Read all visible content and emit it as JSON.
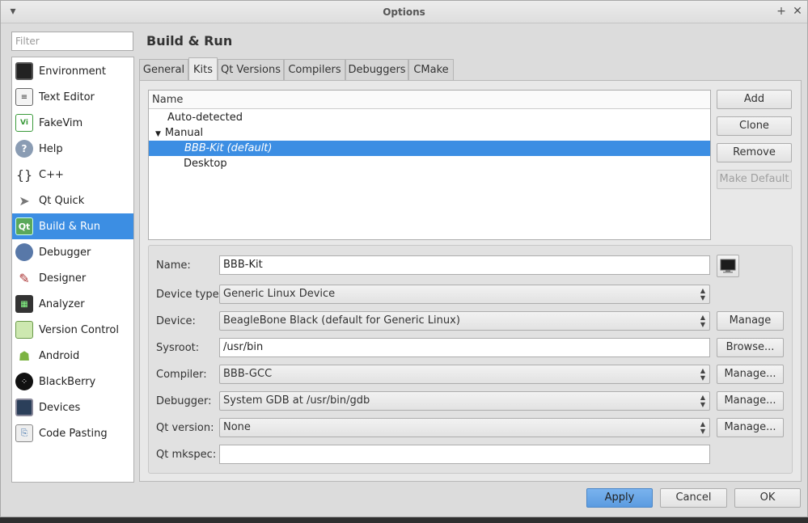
{
  "window": {
    "title": "Options"
  },
  "filter": {
    "placeholder": "Filter"
  },
  "sidebar": {
    "items": [
      {
        "label": "Environment",
        "icon": "monitor-icon"
      },
      {
        "label": "Text Editor",
        "icon": "text-editor-icon"
      },
      {
        "label": "FakeVim",
        "icon": "fakevim-icon"
      },
      {
        "label": "Help",
        "icon": "help-icon"
      },
      {
        "label": "C++",
        "icon": "cpp-braces-icon"
      },
      {
        "label": "Qt Quick",
        "icon": "paper-plane-icon"
      },
      {
        "label": "Build & Run",
        "icon": "qt-build-icon",
        "selected": true
      },
      {
        "label": "Debugger",
        "icon": "bug-icon"
      },
      {
        "label": "Designer",
        "icon": "designer-pen-icon"
      },
      {
        "label": "Analyzer",
        "icon": "analyzer-icon"
      },
      {
        "label": "Version Control",
        "icon": "version-control-icon"
      },
      {
        "label": "Android",
        "icon": "android-icon"
      },
      {
        "label": "BlackBerry",
        "icon": "blackberry-icon"
      },
      {
        "label": "Devices",
        "icon": "device-icon"
      },
      {
        "label": "Code Pasting",
        "icon": "code-paste-icon"
      }
    ]
  },
  "main": {
    "title": "Build & Run",
    "tabs": [
      "General",
      "Kits",
      "Qt Versions",
      "Compilers",
      "Debuggers",
      "CMake"
    ],
    "active_tab": "Kits",
    "kit_list": {
      "header": "Name",
      "rows": [
        "Auto-detected",
        "Manual",
        "BBB-Kit (default)",
        "Desktop"
      ]
    },
    "buttons": {
      "add": "Add",
      "clone": "Clone",
      "remove": "Remove",
      "make_default": "Make Default"
    },
    "form": {
      "name_label": "Name:",
      "name_value": "BBB-Kit",
      "device_type_label": "Device type:",
      "device_type_value": "Generic Linux Device",
      "device_label": "Device:",
      "device_value": "BeagleBone Black (default for Generic Linux)",
      "device_manage": "Manage",
      "sysroot_label": "Sysroot:",
      "sysroot_value": "/usr/bin",
      "sysroot_browse": "Browse...",
      "compiler_label": "Compiler:",
      "compiler_value": "BBB-GCC",
      "compiler_manage": "Manage...",
      "debugger_label": "Debugger:",
      "debugger_value": "System GDB at /usr/bin/gdb",
      "debugger_manage": "Manage...",
      "qt_version_label": "Qt version:",
      "qt_version_value": "None",
      "qt_version_manage": "Manage...",
      "qt_mkspec_label": "Qt mkspec:",
      "qt_mkspec_value": ""
    }
  },
  "footer": {
    "apply": "Apply",
    "cancel": "Cancel",
    "ok": "OK"
  },
  "colors": {
    "selection": "#3c8ee3",
    "window_bg": "#dcdcdc"
  }
}
